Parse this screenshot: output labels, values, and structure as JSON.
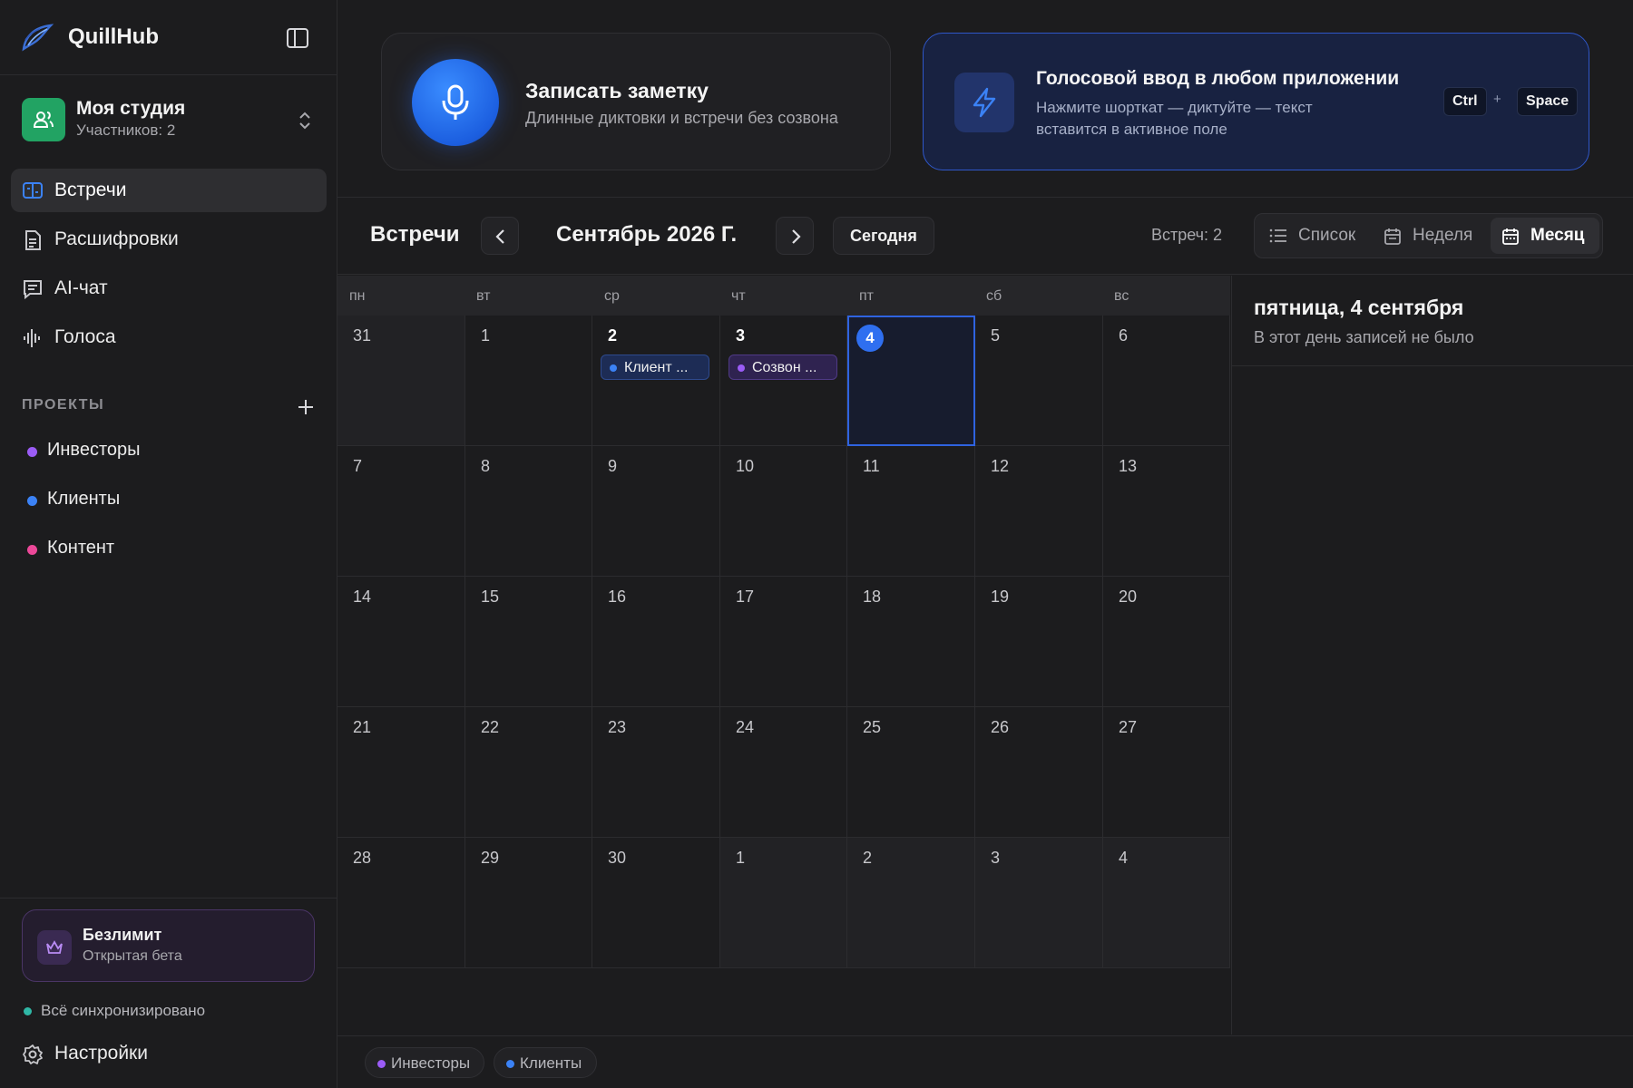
{
  "app": {
    "name": "QuillHub"
  },
  "workspace": {
    "name": "Моя студия",
    "members": "Участников: 2"
  },
  "sidebar": {
    "nav": [
      {
        "label": "Встречи",
        "icon": "meetings-icon",
        "active": true
      },
      {
        "label": "Расшифровки",
        "icon": "document-icon",
        "active": false
      },
      {
        "label": "AI-чат",
        "icon": "chat-icon",
        "active": false
      },
      {
        "label": "Голоса",
        "icon": "waveform-icon",
        "active": false
      }
    ],
    "projects_heading": "ПРОЕКТЫ",
    "projects": [
      {
        "label": "Инвесторы",
        "color": "#9b5cf6"
      },
      {
        "label": "Клиенты",
        "color": "#3b82f6"
      },
      {
        "label": "Контент",
        "color": "#ec4899"
      }
    ],
    "plan": {
      "title": "Безлимит",
      "subtitle": "Открытая бета",
      "icon": "crown-icon"
    },
    "sync_status": "Всё синхронизировано",
    "settings_label": "Настройки"
  },
  "record_card": {
    "title": "Записать заметку",
    "subtitle": "Длинные диктовки и встречи без созвона",
    "icon": "microphone-icon"
  },
  "voice_card": {
    "title": "Голосовой ввод в любом приложении",
    "subtitle": "Нажмите шорткат — диктуйте — текст вставится в активное поле",
    "key1": "Ctrl",
    "plus": "+",
    "key2": "Space",
    "icon": "lightning-icon"
  },
  "toolbar": {
    "title": "Встречи",
    "month": "Сентябрь 2026 Г.",
    "today": "Сегодня",
    "count": "Встреч: 2",
    "views": [
      {
        "label": "Список",
        "icon": "list-icon",
        "active": false
      },
      {
        "label": "Неделя",
        "icon": "calendar-week-icon",
        "active": false
      },
      {
        "label": "Месяц",
        "icon": "calendar-month-icon",
        "active": true
      }
    ]
  },
  "calendar": {
    "weekdays": [
      "пн",
      "вт",
      "ср",
      "чт",
      "пт",
      "сб",
      "вс"
    ],
    "weeks": [
      [
        {
          "d": "31",
          "other": true
        },
        {
          "d": "1"
        },
        {
          "d": "2",
          "strong": true,
          "event": {
            "label": "Клиент ...",
            "color": "#3b82f6",
            "bg": "#1d2c55",
            "border": "#2e4a8e"
          }
        },
        {
          "d": "3",
          "strong": true,
          "event": {
            "label": "Созвон ...",
            "color": "#9b5cf6",
            "bg": "#2f2350",
            "border": "#4f3a86"
          }
        },
        {
          "d": "4",
          "today": true
        },
        {
          "d": "5"
        },
        {
          "d": "6"
        }
      ],
      [
        {
          "d": "7"
        },
        {
          "d": "8"
        },
        {
          "d": "9"
        },
        {
          "d": "10"
        },
        {
          "d": "11"
        },
        {
          "d": "12"
        },
        {
          "d": "13"
        }
      ],
      [
        {
          "d": "14"
        },
        {
          "d": "15"
        },
        {
          "d": "16"
        },
        {
          "d": "17"
        },
        {
          "d": "18"
        },
        {
          "d": "19"
        },
        {
          "d": "20"
        }
      ],
      [
        {
          "d": "21"
        },
        {
          "d": "22"
        },
        {
          "d": "23"
        },
        {
          "d": "24"
        },
        {
          "d": "25"
        },
        {
          "d": "26"
        },
        {
          "d": "27"
        }
      ],
      [
        {
          "d": "28"
        },
        {
          "d": "29"
        },
        {
          "d": "30"
        },
        {
          "d": "1",
          "other": true
        },
        {
          "d": "2",
          "other": true
        },
        {
          "d": "3",
          "other": true
        },
        {
          "d": "4",
          "other": true
        }
      ]
    ]
  },
  "day_panel": {
    "title": "пятница, 4 сентября",
    "empty": "В этот день записей не было"
  },
  "legend": [
    {
      "label": "Инвесторы",
      "color": "#9b5cf6"
    },
    {
      "label": "Клиенты",
      "color": "#3b82f6"
    }
  ]
}
